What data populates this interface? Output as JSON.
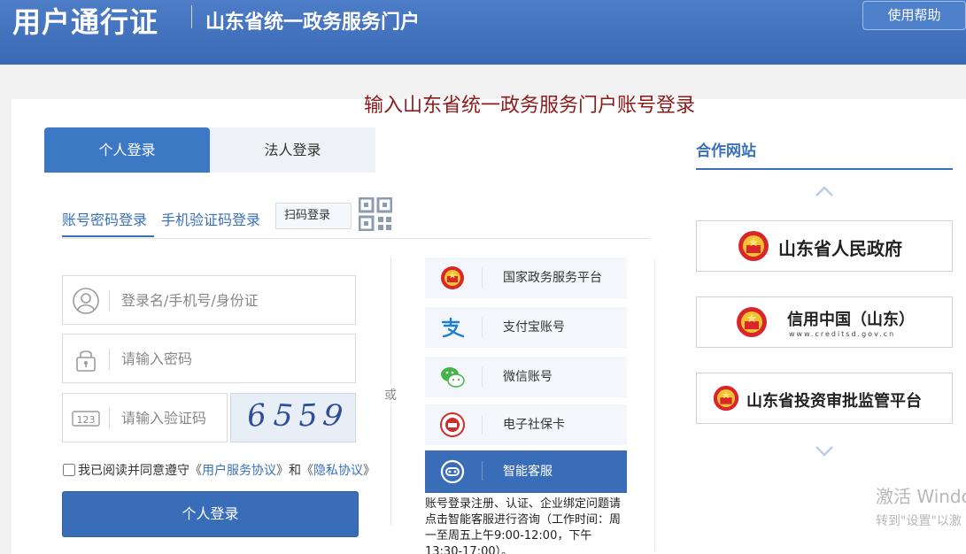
{
  "header": {
    "brand": "用户通行证",
    "portal_name": "山东省统一政务服务门户",
    "help_label": "使用帮助"
  },
  "page_title": "输入山东省统一政务服务门户账号登录",
  "tabs": [
    {
      "label": "个人登录",
      "active": true
    },
    {
      "label": "法人登录",
      "active": false
    }
  ],
  "subtabs": {
    "password": "账号密码登录",
    "sms": "手机验证码登录",
    "scan": "扫码登录"
  },
  "form": {
    "username_placeholder": "登录名/手机号/身份证",
    "password_placeholder": "请输入密码",
    "captcha_placeholder": "请输入验证码",
    "captcha_icon_text": "123",
    "captcha_digits": [
      "6",
      "5",
      "5",
      "9"
    ],
    "agree_text": "我已阅读并同意遵守",
    "quote_open": "《",
    "quote_close": "》",
    "and_text": "和",
    "user_agreement": "用户服务协议",
    "privacy_policy": "隐私协议",
    "submit_label": "个人登录"
  },
  "or_text": "或",
  "alt_logins": [
    {
      "label": "国家政务服务平台",
      "icon": "national-emblem-icon"
    },
    {
      "label": "支付宝账号",
      "icon": "alipay-icon"
    },
    {
      "label": "微信账号",
      "icon": "wechat-icon"
    },
    {
      "label": "电子社保卡",
      "icon": "social-security-card-icon"
    },
    {
      "label": "智能客服",
      "icon": "robot-service-icon",
      "active": true
    }
  ],
  "service_note": "账号登录注册、认证、企业绑定问题请点击智能客服进行咨询（工作时间：周一至周五上午9:00-12:00，下午13:30-17:00）。",
  "sidebar": {
    "title": "合作网站",
    "partners": [
      {
        "name": "山东省人民政府"
      },
      {
        "name": "信用中国（山东）",
        "url": "www.creditsd.gov.cn"
      },
      {
        "name": "山东省投资审批监管平台"
      }
    ]
  },
  "watermark": {
    "line1": "激活 Windo",
    "line2": "转到\"设置\"以激"
  },
  "colors": {
    "header": "#3a69b6",
    "accent": "#3a70b9",
    "title": "#8b1a1a"
  }
}
